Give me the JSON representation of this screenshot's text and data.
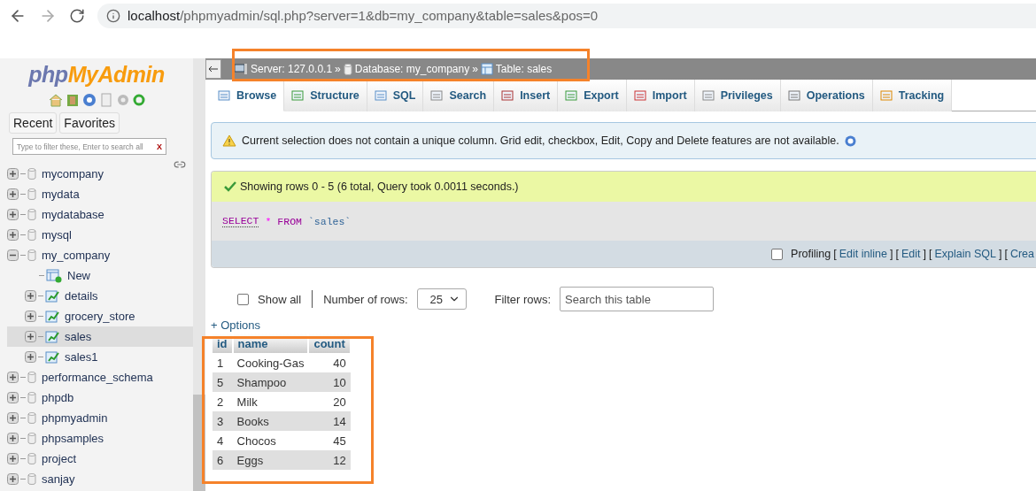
{
  "browser": {
    "url_host": "localhost",
    "url_path": "/phpmyadmin/sql.php?server=1&db=my_company&table=sales&pos=0"
  },
  "sidebar": {
    "logo_php": "php",
    "logo_rest": "MyAdmin",
    "tabs": [
      {
        "label": "Recent"
      },
      {
        "label": "Favorites"
      }
    ],
    "filter": {
      "placeholder": "Type to filter these, Enter to search all",
      "clear": "X"
    },
    "tree": [
      {
        "label": "mycompany",
        "kind": "db",
        "expanded": false,
        "selected": false
      },
      {
        "label": "mydata",
        "kind": "db",
        "expanded": false,
        "selected": false
      },
      {
        "label": "mydatabase",
        "kind": "db",
        "expanded": false,
        "selected": false
      },
      {
        "label": "mysql",
        "kind": "db",
        "expanded": false,
        "selected": false
      },
      {
        "label": "my_company",
        "kind": "db",
        "expanded": true,
        "selected": false,
        "children": [
          {
            "label": "New",
            "kind": "new",
            "selected": false
          },
          {
            "label": "details",
            "kind": "table",
            "expanded": false,
            "selected": false
          },
          {
            "label": "grocery_store",
            "kind": "table",
            "expanded": false,
            "selected": false
          },
          {
            "label": "sales",
            "kind": "table",
            "expanded": false,
            "selected": true
          },
          {
            "label": "sales1",
            "kind": "table",
            "expanded": false,
            "selected": false
          }
        ]
      },
      {
        "label": "performance_schema",
        "kind": "db",
        "expanded": false,
        "selected": false
      },
      {
        "label": "phpdb",
        "kind": "db",
        "expanded": false,
        "selected": false
      },
      {
        "label": "phpmyadmin",
        "kind": "db",
        "expanded": false,
        "selected": false
      },
      {
        "label": "phpsamples",
        "kind": "db",
        "expanded": false,
        "selected": false
      },
      {
        "label": "project",
        "kind": "db",
        "expanded": false,
        "selected": false
      },
      {
        "label": "sanjay",
        "kind": "db",
        "expanded": false,
        "selected": false
      }
    ]
  },
  "breadcrumb": [
    {
      "kind": "server",
      "label": "Server: 127.0.0.1",
      "sep": "»"
    },
    {
      "kind": "database",
      "label": "Database: my_company",
      "sep": "»"
    },
    {
      "kind": "table",
      "label": "Table: sales"
    }
  ],
  "tabs": [
    {
      "label": "Browse",
      "selected": true
    },
    {
      "label": "Structure",
      "selected": false
    },
    {
      "label": "SQL",
      "selected": false
    },
    {
      "label": "Search",
      "selected": false
    },
    {
      "label": "Insert",
      "selected": false
    },
    {
      "label": "Export",
      "selected": false
    },
    {
      "label": "Import",
      "selected": false
    },
    {
      "label": "Privileges",
      "selected": false
    },
    {
      "label": "Operations",
      "selected": false
    },
    {
      "label": "Tracking",
      "selected": false
    }
  ],
  "notice": "Current selection does not contain a unique column. Grid edit, checkbox, Edit, Copy and Delete features are not available.",
  "success": "Showing rows 0 - 5 (6 total, Query took 0.0011 seconds.)",
  "query": [
    {
      "kind": "keyword",
      "text": "SELECT"
    },
    {
      "kind": "operator",
      "text": "*"
    },
    {
      "kind": "keyword",
      "text": "FROM"
    },
    {
      "kind": "ident",
      "text": "`sales`"
    }
  ],
  "profiling": {
    "label": "Profiling",
    "checked": false,
    "parts": [
      {
        "kind": "bracket",
        "text": "["
      },
      {
        "kind": "link",
        "text": "Edit inline"
      },
      {
        "kind": "bracket",
        "text": "]"
      },
      {
        "kind": "bracket",
        "text": "["
      },
      {
        "kind": "link",
        "text": "Edit"
      },
      {
        "kind": "bracket",
        "text": "]"
      },
      {
        "kind": "bracket",
        "text": "["
      },
      {
        "kind": "link",
        "text": "Explain SQL"
      },
      {
        "kind": "bracket",
        "text": "]"
      },
      {
        "kind": "bracket",
        "text": "["
      },
      {
        "kind": "link",
        "text": "Crea"
      }
    ]
  },
  "controls": {
    "show_all": {
      "label": "Show all",
      "checked": false
    },
    "rows_label": "Number of rows:",
    "rows_value": "25",
    "filter_label": "Filter rows:",
    "filter_placeholder": "Search this table"
  },
  "options_link": "+ Options",
  "table": {
    "columns": [
      "id",
      "name",
      "count"
    ],
    "rows": [
      [
        "1",
        "Cooking-Gas",
        "40"
      ],
      [
        "5",
        "Shampoo",
        "10"
      ],
      [
        "2",
        "Milk",
        "20"
      ],
      [
        "3",
        "Books",
        "14"
      ],
      [
        "4",
        "Chocos",
        "45"
      ],
      [
        "6",
        "Eggs",
        "12"
      ]
    ]
  }
}
